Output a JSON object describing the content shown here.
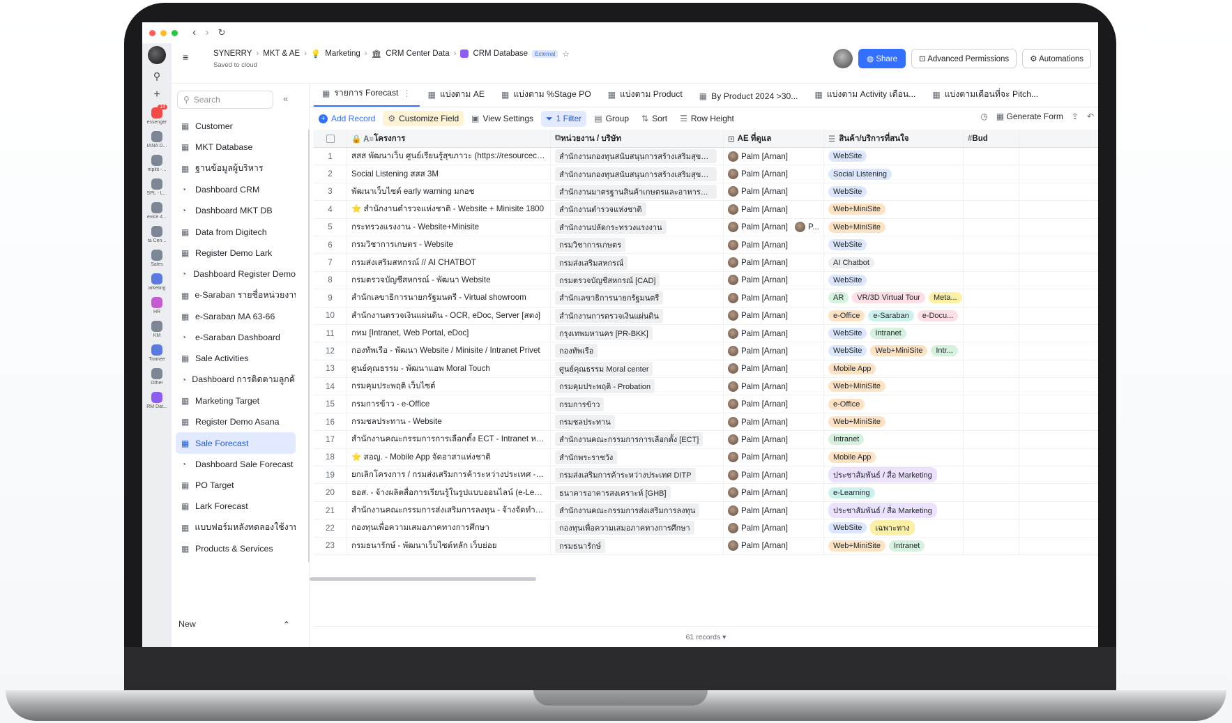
{
  "header": {
    "breadcrumbs": [
      "SYNERRY",
      "MKT & AE",
      "Marketing",
      "CRM Center Data",
      "CRM Database"
    ],
    "external_label": "External",
    "saved_label": "Saved to cloud",
    "share_label": "Share",
    "advanced_permissions_label": "Advanced Permissions",
    "automations_label": "Automations"
  },
  "rail": {
    "badge": "14",
    "items": [
      "essenger",
      "IANA D...",
      "mpliti -...",
      "SPL - L...",
      "evice 4...",
      "ta Cen...",
      "Sales",
      "arketing",
      "HR",
      "KM",
      "Trainee",
      "Other",
      "RM Dat..."
    ]
  },
  "sidebar": {
    "search_placeholder": "Search",
    "new_label": "New",
    "items": [
      {
        "label": "Customer",
        "icon": "grid-icon"
      },
      {
        "label": "MKT Database",
        "icon": "grid-icon"
      },
      {
        "label": "ฐานข้อมูลผู้บริหาร",
        "icon": "grid-icon"
      },
      {
        "label": "Dashboard CRM",
        "icon": "dashboard-icon"
      },
      {
        "label": "Dashboard MKT DB",
        "icon": "dashboard-icon"
      },
      {
        "label": "Data from Digitech",
        "icon": "grid-icon"
      },
      {
        "label": "Register Demo Lark",
        "icon": "grid-icon"
      },
      {
        "label": "Dashboard Register Demo",
        "icon": "dashboard-icon"
      },
      {
        "label": "e-Saraban รายชื่อหน่วยงาน",
        "icon": "grid-icon"
      },
      {
        "label": "e-Saraban MA 63-66",
        "icon": "grid-icon"
      },
      {
        "label": "e-Saraban Dashboard",
        "icon": "dashboard-icon"
      },
      {
        "label": "Sale Activities",
        "icon": "grid-icon"
      },
      {
        "label": "Dashboard การติดตามลูกค้า",
        "icon": "dashboard-icon"
      },
      {
        "label": "Marketing Target",
        "icon": "grid-icon"
      },
      {
        "label": "Register Demo Asana",
        "icon": "grid-icon"
      },
      {
        "label": "Sale Forecast",
        "icon": "grid-icon"
      },
      {
        "label": "Dashboard Sale Forecast",
        "icon": "dashboard-icon"
      },
      {
        "label": "PO Target",
        "icon": "grid-icon"
      },
      {
        "label": "Lark Forecast",
        "icon": "grid-icon"
      },
      {
        "label": "แบบฟอร์มหลังทดลองใช้งาน",
        "icon": "grid-icon"
      },
      {
        "label": "Products & Services",
        "icon": "grid-icon"
      }
    ]
  },
  "tabs": [
    "รายการ Forecast",
    "แบ่งตาม AE",
    "แบ่งตาม %Stage PO",
    "แบ่งตาม Product",
    "By Product 2024 >30...",
    "แบ่งตาม Activity เดือน...",
    "แบ่งตามเดือนที่จะ Pitch..."
  ],
  "toolbar": {
    "add_record": "Add Record",
    "customize_field": "Customize Field",
    "view_settings": "View Settings",
    "filter": "1 Filter",
    "group": "Group",
    "sort": "Sort",
    "row_height": "Row Height",
    "generate_form": "Generate Form"
  },
  "columns": [
    "โครงการ",
    "หน่วยงาน / บริษัท",
    "AE ที่ดูแล",
    "สินค้า/บริการที่สนใจ",
    "Bud"
  ],
  "colors": {
    "accent": "#3370ff",
    "pill_blue": "#dce7fd",
    "pill_orange": "#fde3c3",
    "pill_green": "#d6f2df",
    "pill_purple": "#ece2fe",
    "pill_grey": "#eceef1",
    "pill_teal": "#cdf2ee",
    "pill_yellow": "#fbf0a6",
    "pill_pink": "#fde0e6"
  },
  "rows": [
    {
      "num": "1",
      "project": "สสส พัฒนาเว็บ ศูนย์เรียนรู้สุขภาวะ (https://resourcecent...",
      "org": "สำนักงานกองทุนสนับสนุนการสร้างเสริมสุขภา...",
      "ae": "Palm [Arnan]",
      "products": [
        {
          "t": "WebSite",
          "c": "blue"
        }
      ]
    },
    {
      "num": "2",
      "project": "Social Listening สสส 3M",
      "org": "สำนักงานกองทุนสนับสนุนการสร้างเสริมสุขภา...",
      "ae": "Palm [Arnan]",
      "products": [
        {
          "t": "Social Listening",
          "c": "blue"
        }
      ]
    },
    {
      "num": "3",
      "project": "พัฒนาเว็บไซต์ early warning มกอช",
      "org": "สำนักงานมาตรฐานสินค้าเกษตรและอาหารแห่ง...",
      "ae": "Palm [Arnan]",
      "products": [
        {
          "t": "WebSite",
          "c": "blue"
        }
      ]
    },
    {
      "num": "4",
      "project": "⭐ สำนักงานตำรวจแห่งชาติ - Website + Minisite 1800",
      "org": "สำนักงานตำรวจแห่งชาติ",
      "ae": "Palm [Arnan]",
      "products": [
        {
          "t": "Web+MiniSite",
          "c": "orange"
        }
      ]
    },
    {
      "num": "5",
      "project": "กระทรวงแรงงาน - Website+Minisite",
      "org": "สำนักงานปลัดกระทรวงแรงงาน",
      "ae": "Palm [Arnan]",
      "ae2": "P...",
      "products": [
        {
          "t": "Web+MiniSite",
          "c": "orange"
        }
      ]
    },
    {
      "num": "6",
      "project": "กรมวิชาการเกษตร - Website",
      "org": "กรมวิชาการเกษตร",
      "ae": "Palm [Arnan]",
      "products": [
        {
          "t": "WebSite",
          "c": "blue"
        }
      ]
    },
    {
      "num": "7",
      "project": "กรมส่งเสริมสหกรณ์ // AI CHATBOT",
      "org": "กรมส่งเสริมสหกรณ์",
      "ae": "Palm [Arnan]",
      "products": [
        {
          "t": "AI Chatbot",
          "c": "grey"
        }
      ]
    },
    {
      "num": "8",
      "project": "กรมตรวจบัญชีสหกรณ์ - พัฒนา Website",
      "org": "กรมตรวจบัญชีสหกรณ์ [CAD]",
      "ae": "Palm [Arnan]",
      "products": [
        {
          "t": "WebSite",
          "c": "blue"
        }
      ]
    },
    {
      "num": "9",
      "project": "สำนักเลขาธิการนายกรัฐมนตรี - Virtual showroom",
      "org": "สำนักเลขาธิการนายกรัฐมนตรี",
      "ae": "Palm [Arnan]",
      "products": [
        {
          "t": "AR",
          "c": "green"
        },
        {
          "t": "VR/3D Virtual Tour",
          "c": "pink"
        },
        {
          "t": "Meta...",
          "c": "yellow"
        }
      ]
    },
    {
      "num": "10",
      "project": "สำนักงานตรวจเงินแผ่นดิน - OCR, eDoc, Server [สตง]",
      "org": "สำนักงานการตรวจเงินแผ่นดิน",
      "ae": "Palm [Arnan]",
      "products": [
        {
          "t": "e-Office",
          "c": "orange"
        },
        {
          "t": "e-Saraban",
          "c": "teal"
        },
        {
          "t": "e-Docu...",
          "c": "pink"
        }
      ]
    },
    {
      "num": "11",
      "project": "กทม [Intranet, Web Portal, eDoc]",
      "org": "กรุงเทพมหานคร [PR-BKK]",
      "ae": "Palm [Arnan]",
      "products": [
        {
          "t": "WebSite",
          "c": "blue"
        },
        {
          "t": "Intranet",
          "c": "green"
        }
      ]
    },
    {
      "num": "12",
      "project": "กองทัพเรือ - พัฒนา Website / Minisite / Intranet Privet",
      "org": "กองทัพเรือ",
      "ae": "Palm [Arnan]",
      "products": [
        {
          "t": "WebSite",
          "c": "blue"
        },
        {
          "t": "Web+MiniSite",
          "c": "orange"
        },
        {
          "t": "Intr...",
          "c": "green"
        }
      ]
    },
    {
      "num": "13",
      "project": "ศูนย์คุณธรรม - พัฒนาแอพ Moral Touch",
      "org": "ศูนย์คุณธรรม Moral center",
      "ae": "Palm [Arnan]",
      "products": [
        {
          "t": "Mobile App",
          "c": "orange"
        }
      ]
    },
    {
      "num": "14",
      "project": "กรมคุมประพฤติ เว็บไซต์",
      "org": "กรมคุมประพฤติ - Probation",
      "ae": "Palm [Arnan]",
      "products": [
        {
          "t": "Web+MiniSite",
          "c": "orange"
        }
      ]
    },
    {
      "num": "15",
      "project": "กรมการข้าว - e-Office",
      "org": "กรมการข้าว",
      "ae": "Palm [Arnan]",
      "products": [
        {
          "t": "e-Office",
          "c": "orange"
        }
      ]
    },
    {
      "num": "16",
      "project": "กรมชลประทาน - Website",
      "org": "กรมชลประทาน",
      "ae": "Palm [Arnan]",
      "products": [
        {
          "t": "Web+MiniSite",
          "c": "orange"
        }
      ]
    },
    {
      "num": "17",
      "project": "สำนักงานคณะกรรมการการเลือกตั้ง ECT - Intranet หลังจบ...",
      "org": "สำนักงานคณะกรรมการการเลือกตั้ง [ECT]",
      "ae": "Palm [Arnan]",
      "products": [
        {
          "t": "Intranet",
          "c": "green"
        }
      ]
    },
    {
      "num": "18",
      "project": "⭐ สอญ. - Mobile App จัดอาสาแห่งชาติ",
      "org": "สำนักพระราชวัง",
      "ae": "Palm [Arnan]",
      "products": [
        {
          "t": "Mobile App",
          "c": "orange"
        }
      ]
    },
    {
      "num": "19",
      "project": "ยกเลิกโครงการ / กรมส่งเสริมการค้าระหว่างประเทศ - โครง...",
      "org": "กรมส่งเสริมการค้าระหว่างประเทศ DITP",
      "ae": "Palm [Arnan]",
      "products": [
        {
          "t": "ประชาสัมพันธ์ / สื่อ Marketing",
          "c": "purple"
        }
      ]
    },
    {
      "num": "20",
      "project": "ธอส. - จ้างผลิตสื่อการเรียนรู้ในรูปแบบออนไลน์ (e-Learnin...",
      "org": "ธนาคารอาคารสงเคราะห์ [GHB]",
      "ae": "Palm [Arnan]",
      "products": [
        {
          "t": "e-Learning",
          "c": "teal"
        }
      ]
    },
    {
      "num": "21",
      "project": "สำนักงานคณะกรรมการส่งเสริมการลงทุน - จ้างจัดทำสื่อเผย...",
      "org": "สำนักงานคณะกรรมการส่งเสริมการลงทุน",
      "ae": "Palm [Arnan]",
      "products": [
        {
          "t": "ประชาสัมพันธ์ / สื่อ Marketing",
          "c": "purple"
        }
      ]
    },
    {
      "num": "22",
      "project": "กองทุนเพื่อความเสมอภาคทางการศึกษา",
      "org": "กองทุนเพื่อความเสมอภาคทางการศึกษา",
      "ae": "Palm [Arnan]",
      "products": [
        {
          "t": "WebSite",
          "c": "blue"
        },
        {
          "t": "เฉพาะทาง",
          "c": "yellow"
        }
      ]
    },
    {
      "num": "23",
      "project": "กรมธนารักษ์ - พัฒนาเว็บไซต์หลัก เว็บย่อย",
      "org": "กรมธนารักษ์",
      "ae": "Palm [Arnan]",
      "products": [
        {
          "t": "Web+MiniSite",
          "c": "orange"
        },
        {
          "t": "Intranet",
          "c": "green"
        }
      ]
    }
  ],
  "footer": {
    "records": "61 records"
  }
}
